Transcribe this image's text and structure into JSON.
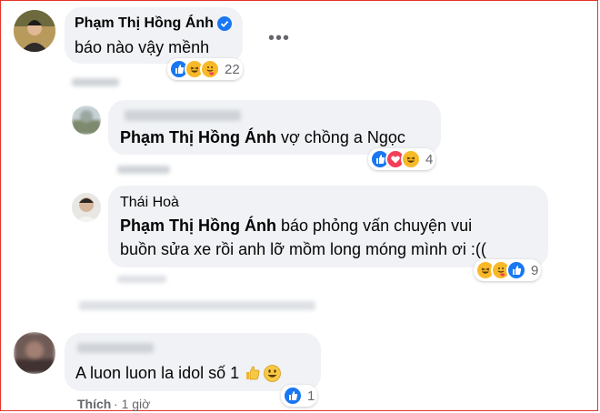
{
  "comments": [
    {
      "author": "Phạm Thị Hồng Ánh",
      "text": "báo nào vậy mềnh",
      "reaction_count": "22"
    },
    {
      "mention": "Phạm Thị Hồng Ánh",
      "text": " vợ chồng a Ngọc",
      "reaction_count": "4"
    },
    {
      "author": "Thái Hoà",
      "mention": "Phạm Thị Hồng Ánh",
      "text_line1": " báo phỏng vấn chuyện vui",
      "text_line2": "buồn sửa xe rồi anh lỡ mồm long móng mình ơi :((",
      "reaction_count": "9"
    },
    {
      "text": "A luon luon la idol số 1",
      "reaction_count": "1",
      "like_label": "Thích",
      "time": "1 giờ"
    }
  ],
  "more_options_glyph": "•••",
  "icons": [
    "verified-badge-icon",
    "like-reaction-icon",
    "haha-reaction-icon",
    "love-reaction-icon",
    "thumbs-up-emoji",
    "grinning-emoji"
  ],
  "colors": {
    "like": "#1877f2",
    "haha": "#f7b928",
    "love": "#f33e58",
    "frame": "#e4322b"
  }
}
